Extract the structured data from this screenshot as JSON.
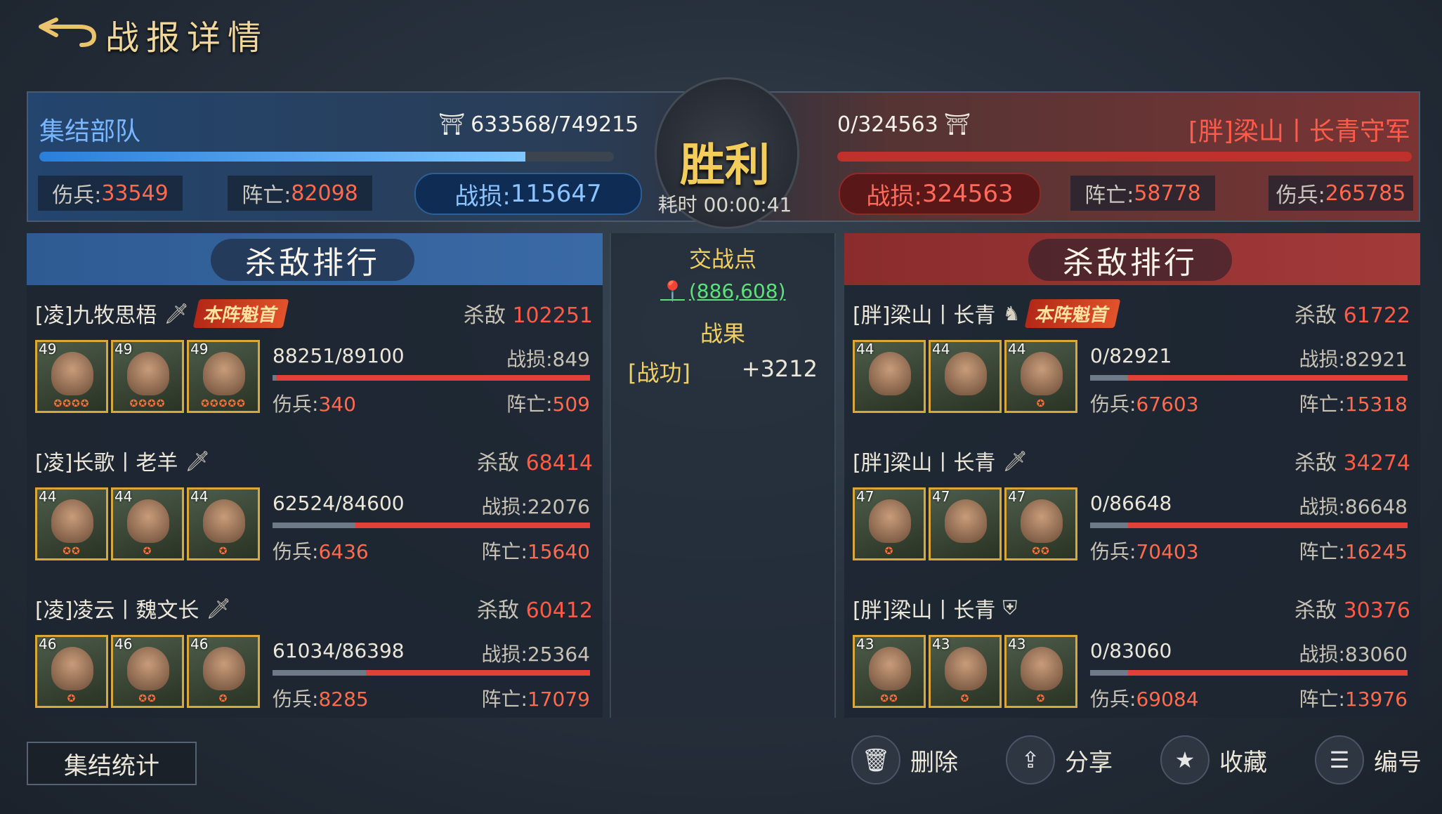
{
  "header": {
    "title": "战报详情",
    "back_icon": "back-arrow-icon"
  },
  "summary": {
    "left": {
      "name": "集结部队",
      "troops": "633568/749215",
      "troops_fraction": 0.846,
      "wounded_label": "伤兵:",
      "wounded": "33549",
      "dead_label": "阵亡:",
      "dead": "82098",
      "loss_label": "战损:",
      "loss": "115647"
    },
    "right": {
      "name": "[胖]梁山丨长青守军",
      "troops": "0/324563",
      "troops_fraction": 0.0,
      "wounded_label": "伤兵:",
      "wounded": "265785",
      "dead_label": "阵亡:",
      "dead": "58778",
      "loss_label": "战损:",
      "loss": "324563"
    },
    "result": "胜利",
    "duration": "耗时 00:00:41"
  },
  "left_panel": {
    "title": "杀敌排行",
    "entries": [
      {
        "name": "[凌]九牧思梧",
        "icon": "sword-icon",
        "badge": "本阵魁首",
        "kills_label": "杀敌",
        "kills": "102251",
        "levels": [
          "49",
          "49",
          "49"
        ],
        "stars": [
          "✪✪✪✪",
          "✪✪✪✪",
          "✪✪✪✪✪"
        ],
        "hp": "88251/89100",
        "hp_fraction": 0.99,
        "loss": "战损:849",
        "wounded_label": "伤兵:",
        "wounded": "340",
        "dead_label": "阵亡:",
        "dead": "509"
      },
      {
        "name": "[凌]长歌丨老羊",
        "icon": "sword-icon",
        "badge": "",
        "kills_label": "杀敌",
        "kills": "68414",
        "levels": [
          "44",
          "44",
          "44"
        ],
        "stars": [
          "✪✪",
          "✪",
          "✪"
        ],
        "hp": "62524/84600",
        "hp_fraction": 0.739,
        "loss": "战损:22076",
        "wounded_label": "伤兵:",
        "wounded": "6436",
        "dead_label": "阵亡:",
        "dead": "15640"
      },
      {
        "name": "[凌]凌云丨魏文长",
        "icon": "sword-icon",
        "badge": "",
        "kills_label": "杀敌",
        "kills": "60412",
        "levels": [
          "46",
          "46",
          "46"
        ],
        "stars": [
          "✪",
          "✪✪",
          "✪"
        ],
        "hp": "61034/86398",
        "hp_fraction": 0.706,
        "loss": "战损:25364",
        "wounded_label": "伤兵:",
        "wounded": "8285",
        "dead_label": "阵亡:",
        "dead": "17079"
      }
    ]
  },
  "right_panel": {
    "title": "杀敌排行",
    "entries": [
      {
        "name": "[胖]梁山丨长青",
        "icon": "horse-icon",
        "badge": "本阵魁首",
        "kills_label": "杀敌",
        "kills": "61722",
        "levels": [
          "44",
          "44",
          "44"
        ],
        "stars": [
          "",
          "",
          "✪"
        ],
        "hp": "0/82921",
        "hp_fraction": 0.0,
        "loss": "战损:82921",
        "wounded_label": "伤兵:",
        "wounded": "67603",
        "dead_label": "阵亡:",
        "dead": "15318"
      },
      {
        "name": "[胖]梁山丨长青",
        "icon": "sword-icon",
        "badge": "",
        "kills_label": "杀敌",
        "kills": "34274",
        "levels": [
          "47",
          "47",
          "47"
        ],
        "stars": [
          "✪",
          "",
          "✪✪"
        ],
        "hp": "0/86648",
        "hp_fraction": 0.0,
        "loss": "战损:86648",
        "wounded_label": "伤兵:",
        "wounded": "70403",
        "dead_label": "阵亡:",
        "dead": "16245"
      },
      {
        "name": "[胖]梁山丨长青",
        "icon": "shield-icon",
        "badge": "",
        "kills_label": "杀敌",
        "kills": "30376",
        "levels": [
          "43",
          "43",
          "43"
        ],
        "stars": [
          "✪✪",
          "✪",
          "✪"
        ],
        "hp": "0/83060",
        "hp_fraction": 0.0,
        "loss": "战损:83060",
        "wounded_label": "伤兵:",
        "wounded": "69084",
        "dead_label": "阵亡:",
        "dead": "13976"
      }
    ]
  },
  "center": {
    "battle_point_label": "交战点",
    "coords": "(886,608)",
    "result_label": "战果",
    "merit_label": "[战功]",
    "merit_value": "+3212"
  },
  "footer": {
    "rally_stats": "集结统计",
    "delete": "删除",
    "share": "分享",
    "favorite": "收藏",
    "number": "编号"
  }
}
